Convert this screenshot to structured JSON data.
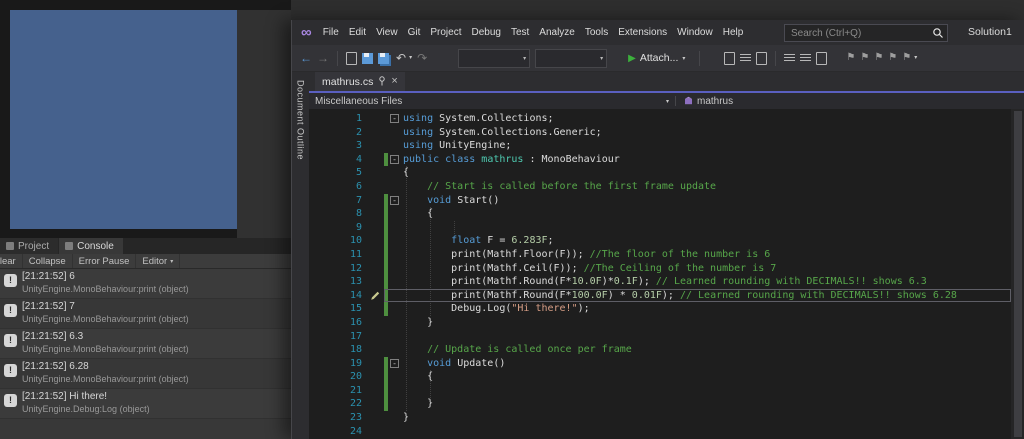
{
  "vs": {
    "logo_glyph": "∞",
    "menu": [
      "File",
      "Edit",
      "View",
      "Git",
      "Project",
      "Debug",
      "Test",
      "Analyze",
      "Tools",
      "Extensions",
      "Window",
      "Help"
    ],
    "search": {
      "placeholder": "Search (Ctrl+Q)"
    },
    "solution_label": "Solution1",
    "toolbar": {
      "attach_label": "Attach..."
    },
    "document_outline": "Document Outline",
    "tab_title": "mathrus.cs",
    "navbar": {
      "project": "Miscellaneous Files",
      "member": "mathrus"
    },
    "colors": {
      "accent": "#5A5FC0",
      "titlebar": "#2D2D30",
      "editor_bg": "#1E1E1E"
    }
  },
  "editor": {
    "current_line": 14,
    "lines": [
      {
        "n": 1,
        "fold": true,
        "change": false,
        "current": false,
        "tokens": [
          [
            "kw",
            "using"
          ],
          [
            "pl",
            " System.Collections;"
          ]
        ]
      },
      {
        "n": 2,
        "fold": false,
        "change": false,
        "current": false,
        "tokens": [
          [
            "kw",
            "using"
          ],
          [
            "pl",
            " System.Collections.Generic;"
          ]
        ]
      },
      {
        "n": 3,
        "fold": false,
        "change": false,
        "current": false,
        "tokens": [
          [
            "kw",
            "using"
          ],
          [
            "pl",
            " UnityEngine;"
          ]
        ]
      },
      {
        "n": 4,
        "fold": true,
        "change": true,
        "current": false,
        "tokens": [
          [
            "kw",
            "public"
          ],
          [
            "pl",
            " "
          ],
          [
            "kw",
            "class"
          ],
          [
            "pl",
            " "
          ],
          [
            "ty",
            "mathrus"
          ],
          [
            "pl",
            " : MonoBehaviour"
          ]
        ]
      },
      {
        "n": 5,
        "fold": false,
        "change": false,
        "current": false,
        "tokens": [
          [
            "pl",
            "{"
          ]
        ]
      },
      {
        "n": 6,
        "fold": false,
        "change": false,
        "current": false,
        "tokens": [
          [
            "cm",
            "    // Start is called before the first frame update"
          ]
        ]
      },
      {
        "n": 7,
        "fold": true,
        "change": true,
        "current": false,
        "tokens": [
          [
            "pl",
            "    "
          ],
          [
            "kw",
            "void"
          ],
          [
            "pl",
            " Start()"
          ]
        ]
      },
      {
        "n": 8,
        "fold": false,
        "change": true,
        "current": false,
        "tokens": [
          [
            "pl",
            "    {"
          ]
        ]
      },
      {
        "n": 9,
        "fold": false,
        "change": true,
        "current": false,
        "tokens": []
      },
      {
        "n": 10,
        "fold": false,
        "change": true,
        "current": false,
        "tokens": [
          [
            "pl",
            "        "
          ],
          [
            "kw",
            "float"
          ],
          [
            "pl",
            " F = "
          ],
          [
            "nu",
            "6.283F"
          ],
          [
            "pl",
            ";"
          ]
        ]
      },
      {
        "n": 11,
        "fold": false,
        "change": true,
        "current": false,
        "tokens": [
          [
            "pl",
            "        print(Mathf.Floor(F)); "
          ],
          [
            "cm",
            "//The floor of the number is 6"
          ]
        ]
      },
      {
        "n": 12,
        "fold": false,
        "change": true,
        "current": false,
        "tokens": [
          [
            "pl",
            "        print(Mathf.Ceil(F)); "
          ],
          [
            "cm",
            "//The Ceiling of the number is 7"
          ]
        ]
      },
      {
        "n": 13,
        "fold": false,
        "change": true,
        "current": false,
        "tokens": [
          [
            "pl",
            "        print(Mathf.Round(F*"
          ],
          [
            "nu",
            "10.0F"
          ],
          [
            "pl",
            ")*"
          ],
          [
            "nu",
            "0.1F"
          ],
          [
            "pl",
            "); "
          ],
          [
            "cm",
            "// Learned rounding with DECIMALS!! shows 6.3"
          ]
        ]
      },
      {
        "n": 14,
        "fold": false,
        "change": true,
        "current": true,
        "tokens": [
          [
            "pl",
            "        print(Mathf.Round(F*"
          ],
          [
            "nu",
            "100.0F"
          ],
          [
            "pl",
            ") * "
          ],
          [
            "nu",
            "0.01F"
          ],
          [
            "pl",
            "); "
          ],
          [
            "cm",
            "// Learned rounding with DECIMALS!! shows 6.28"
          ]
        ]
      },
      {
        "n": 15,
        "fold": false,
        "change": true,
        "current": false,
        "tokens": [
          [
            "pl",
            "        Debug.Log("
          ],
          [
            "st",
            "\"Hi there!\""
          ],
          [
            "pl",
            ");"
          ]
        ]
      },
      {
        "n": 16,
        "fold": false,
        "change": false,
        "current": false,
        "tokens": [
          [
            "pl",
            "    }"
          ]
        ]
      },
      {
        "n": 17,
        "fold": false,
        "change": false,
        "current": false,
        "tokens": []
      },
      {
        "n": 18,
        "fold": false,
        "change": false,
        "current": false,
        "tokens": [
          [
            "cm",
            "    // Update is called once per frame"
          ]
        ]
      },
      {
        "n": 19,
        "fold": true,
        "change": true,
        "current": false,
        "tokens": [
          [
            "pl",
            "    "
          ],
          [
            "kw",
            "void"
          ],
          [
            "pl",
            " Update()"
          ]
        ]
      },
      {
        "n": 20,
        "fold": false,
        "change": true,
        "current": false,
        "tokens": [
          [
            "pl",
            "    {"
          ]
        ]
      },
      {
        "n": 21,
        "fold": false,
        "change": true,
        "current": false,
        "tokens": []
      },
      {
        "n": 22,
        "fold": false,
        "change": true,
        "current": false,
        "tokens": [
          [
            "pl",
            "    }"
          ]
        ]
      },
      {
        "n": 23,
        "fold": false,
        "change": false,
        "current": false,
        "tokens": [
          [
            "pl",
            "}"
          ]
        ]
      },
      {
        "n": 24,
        "fold": false,
        "change": false,
        "current": false,
        "tokens": []
      }
    ]
  },
  "unity": {
    "tabs": [
      "Project",
      "Console"
    ],
    "active_tab": "Console",
    "toolbar_buttons": [
      "Clear",
      "Collapse",
      "Error Pause",
      "Editor"
    ],
    "logs": [
      {
        "message": "[21:21:52] 6",
        "source": "UnityEngine.MonoBehaviour:print (object)"
      },
      {
        "message": "[21:21:52] 7",
        "source": "UnityEngine.MonoBehaviour:print (object)"
      },
      {
        "message": "[21:21:52] 6.3",
        "source": "UnityEngine.MonoBehaviour:print (object)"
      },
      {
        "message": "[21:21:52] 6.28",
        "source": "UnityEngine.MonoBehaviour:print (object)"
      },
      {
        "message": "[21:21:52] Hi there!",
        "source": "UnityEngine.Debug:Log (object)"
      }
    ],
    "colors": {
      "panel_blue": "#45618D"
    }
  }
}
